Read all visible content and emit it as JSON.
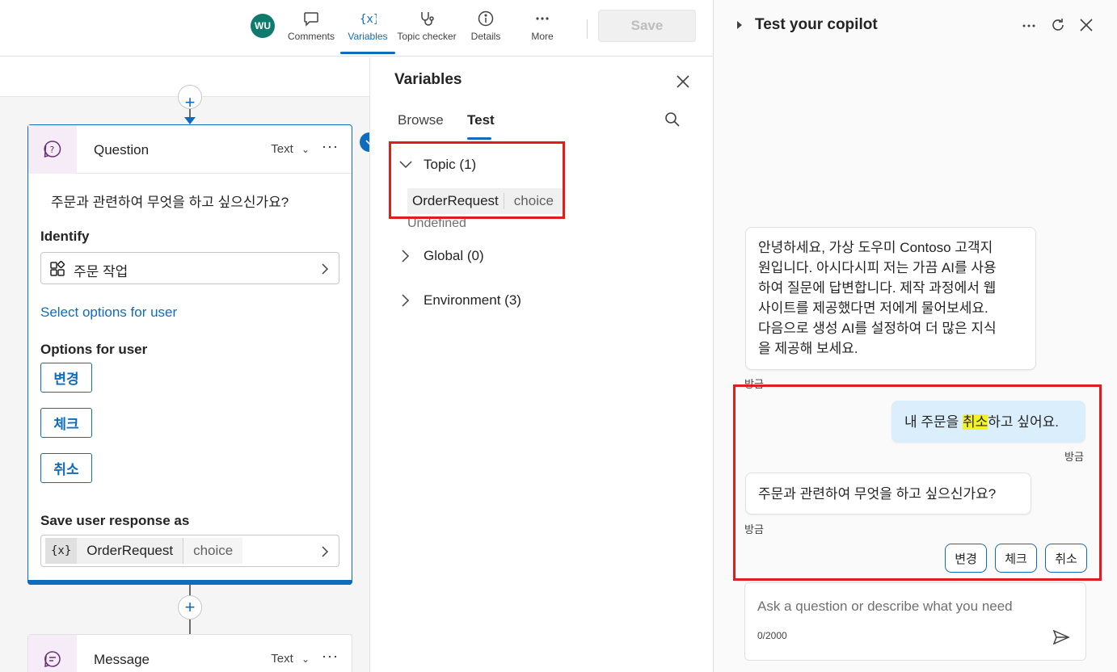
{
  "toolbar": {
    "avatar": "WU",
    "comments": "Comments",
    "variables": "Variables",
    "topic_checker": "Topic checker",
    "details": "Details",
    "more": "More",
    "save": "Save"
  },
  "question_node": {
    "title": "Question",
    "type": "Text",
    "question_text": "주문과 관련하여 무엇을 하고 싶으신가요?",
    "identify_label": "Identify",
    "identify_value": "주문 작업",
    "select_options_link": "Select options for user",
    "options_label": "Options for user",
    "options": [
      "변경",
      "체크",
      "취소"
    ],
    "save_label": "Save user response as",
    "var_icon": "{x}",
    "var_name": "OrderRequest",
    "var_type": "choice"
  },
  "message_node": {
    "title": "Message",
    "type": "Text"
  },
  "variables_panel": {
    "title": "Variables",
    "tab_browse": "Browse",
    "tab_test": "Test",
    "topic": "Topic (1)",
    "var_name": "OrderRequest",
    "var_type": "choice",
    "var_value": "Undefined",
    "global": "Global (0)",
    "environment": "Environment (3)"
  },
  "test_pane": {
    "title": "Test your copilot",
    "bot_greeting_lines": [
      "안녕하세요, 가상 도우미 Contoso 고객지",
      "원입니다. 아시다시피 저는 가끔 AI를 사용",
      "하여 질문에 답변합니다. 제작 과정에서 웹",
      "사이트를 제공했다면 저에게 물어보세요.",
      "다음으로 생성 AI를 설정하여 더 많은 지식",
      "을 제공해 보세요."
    ],
    "timestamp": "방금",
    "user_msg_before": "내 주문을 ",
    "user_msg_highlight": "취소",
    "user_msg_after": "하고 싶어요.",
    "bot_question": "주문과 관련하여 무엇을 하고 싶으신가요?",
    "quick_replies": [
      "변경",
      "체크",
      "취소"
    ],
    "input_placeholder": "Ask a question or describe what you need",
    "char_count": "0/2000"
  },
  "colors": {
    "accent": "#0f6cbd",
    "highlight_box": "#e01c1c",
    "user_bubble": "#dbeefb",
    "highlight": "#f3f322"
  }
}
